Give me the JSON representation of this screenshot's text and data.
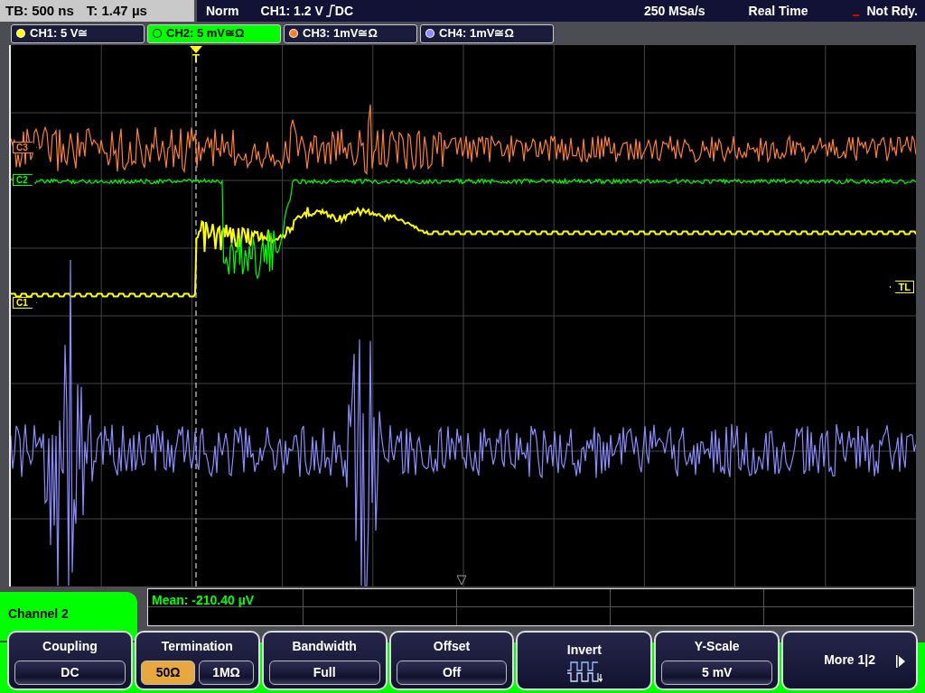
{
  "status_bar": {
    "timebase": "TB: 500 ns",
    "trigger_time": "T: 1.47 µs",
    "trigger_mode": "Norm",
    "trigger_source": "CH1: 1.2 V",
    "trigger_coupling": "DC",
    "sample_rate": "250 MSa/s",
    "acquisition_mode": "Real Time",
    "status": "Not Rdy."
  },
  "channels": [
    {
      "label": "CH1: 5 V≅",
      "color": "#ffff00",
      "selected": false
    },
    {
      "label": "CH2: 5 mV≅Ω",
      "color": "#00ff00",
      "selected": true
    },
    {
      "label": "CH3: 1mV≅Ω",
      "color": "#ff8030",
      "selected": false
    },
    {
      "label": "CH4: 1mV≅Ω",
      "color": "#8c8cff",
      "selected": false
    }
  ],
  "screen": {
    "trigger_marker": "T",
    "trigger_level_marker": "TL",
    "channel_markers": [
      {
        "label": "C3",
        "color": "#ff8030"
      },
      {
        "label": "C2",
        "color": "#00ff00"
      },
      {
        "label": "C1",
        "color": "#ffff00"
      }
    ]
  },
  "menu": {
    "title": "Channel 2",
    "measurement": "Mean: -210.40 µV",
    "softkeys": [
      {
        "kind": "value",
        "title": "Coupling",
        "value": "DC"
      },
      {
        "kind": "toggle",
        "title": "Termination",
        "options": [
          {
            "label": "50Ω",
            "selected": true
          },
          {
            "label": "1MΩ",
            "selected": false
          }
        ]
      },
      {
        "kind": "value",
        "title": "Bandwidth",
        "value": "Full"
      },
      {
        "kind": "value",
        "title": "Offset",
        "value": "Off"
      },
      {
        "kind": "icon",
        "title": "Invert"
      },
      {
        "kind": "value",
        "title": "Y-Scale",
        "value": "5 mV"
      },
      {
        "kind": "more",
        "title": "More 1|2"
      }
    ]
  }
}
